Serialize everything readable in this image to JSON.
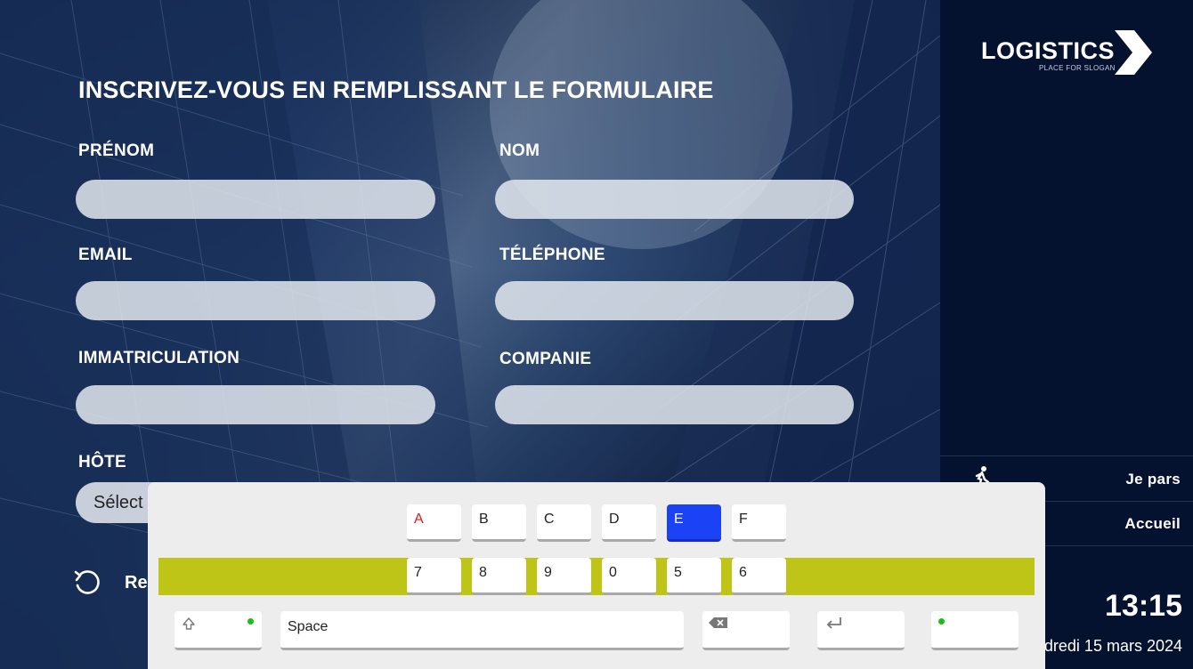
{
  "form": {
    "title": "INSCRIVEZ-VOUS EN REMPLISSANT LE FORMULAIRE",
    "fields": {
      "prenom": {
        "label": "PRÉNOM",
        "value": ""
      },
      "nom": {
        "label": "NOM",
        "value": ""
      },
      "email": {
        "label": "EMAIL",
        "value": ""
      },
      "telephone": {
        "label": "TÉLÉPHONE",
        "value": ""
      },
      "immatriculation": {
        "label": "IMMATRICULATION",
        "value": ""
      },
      "companie": {
        "label": "COMPANIE",
        "value": ""
      },
      "hote": {
        "label": "HÔTE",
        "selected": "Sélect"
      }
    },
    "reset_label": "Re"
  },
  "sidebar": {
    "logo_text": "LOGISTICS",
    "logo_slogan": "PLACE FOR SLOGAN",
    "items": [
      {
        "label": "Je pars",
        "icon": "walking-person-icon"
      },
      {
        "label": "Accueil"
      }
    ],
    "time": "13:15",
    "date": "dredi 15 mars 2024"
  },
  "keyboard": {
    "letter_row": [
      "A",
      "B",
      "C",
      "D",
      "E",
      "F"
    ],
    "number_row": [
      "7",
      "8",
      "9",
      "0",
      "5",
      "6"
    ],
    "active_key": "E",
    "space_label": "Space",
    "icons": [
      "shift-icon",
      "backspace-icon",
      "enter-icon"
    ],
    "colors": {
      "active": "#1c42f5",
      "band": "#bfc516",
      "indicator": "#16c016",
      "first_letter": "#e01818"
    }
  }
}
